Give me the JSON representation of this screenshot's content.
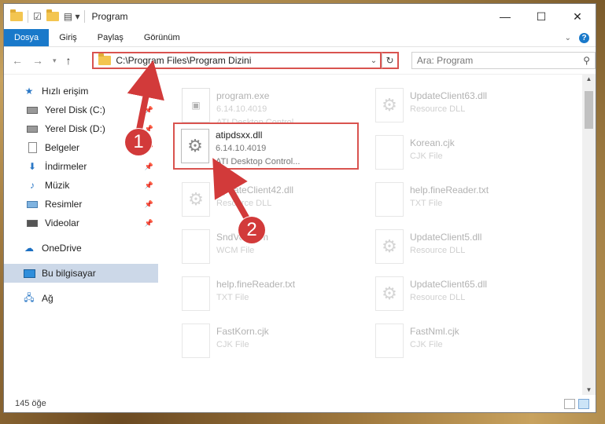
{
  "window": {
    "title": "Program"
  },
  "ribbon": {
    "tabs": [
      "Dosya",
      "Giriş",
      "Paylaş",
      "Görünüm"
    ]
  },
  "address": {
    "path": "C:\\Program Files\\Program Dizini"
  },
  "search": {
    "placeholder": "Ara: Program"
  },
  "sidebar": {
    "items": [
      {
        "label": "Hızlı erişim",
        "icon": "star-icon"
      },
      {
        "label": "Yerel Disk (C:)",
        "icon": "drive-icon"
      },
      {
        "label": "Yerel Disk (D:)",
        "icon": "drive-icon"
      },
      {
        "label": "Belgeler",
        "icon": "documents-icon"
      },
      {
        "label": "İndirmeler",
        "icon": "download-icon"
      },
      {
        "label": "Müzik",
        "icon": "music-icon"
      },
      {
        "label": "Resimler",
        "icon": "pictures-icon"
      },
      {
        "label": "Videolar",
        "icon": "videos-icon"
      },
      {
        "label": "OneDrive",
        "icon": "cloud-icon"
      },
      {
        "label": "Bu bilgisayar",
        "icon": "computer-icon"
      },
      {
        "label": "Ağ",
        "icon": "network-icon"
      }
    ]
  },
  "files": [
    {
      "name": "program.exe",
      "line2": "6.14.10.4019",
      "line3": "ATI Desktop Control..."
    },
    {
      "name": "UpdateClient63.dll",
      "line2": "Resource DLL",
      "line3": ""
    },
    {
      "name": "atipdsxx.dll",
      "line2": "6.14.10.4019",
      "line3": "ATI Desktop Control..."
    },
    {
      "name": "Korean.cjk",
      "line2": "CJK File",
      "line3": ""
    },
    {
      "name": "UpdateClient42.dll",
      "line2": "Resource DLL",
      "line3": ""
    },
    {
      "name": "help.fineReader.txt",
      "line2": "TXT File",
      "line3": ""
    },
    {
      "name": "SndVol.wcm",
      "line2": "WCM File",
      "line3": ""
    },
    {
      "name": "UpdateClient5.dll",
      "line2": "Resource DLL",
      "line3": ""
    },
    {
      "name": "help.fineReader.txt",
      "line2": "TXT File",
      "line3": ""
    },
    {
      "name": "UpdateClient65.dll",
      "line2": "Resource DLL",
      "line3": ""
    },
    {
      "name": "FastKorn.cjk",
      "line2": "CJK File",
      "line3": ""
    },
    {
      "name": "FastNml.cjk",
      "line2": "CJK File",
      "line3": ""
    }
  ],
  "status": {
    "count": "145 öğe"
  },
  "annotations": {
    "step1": "1",
    "step2": "2",
    "color": "#d23a3a"
  }
}
